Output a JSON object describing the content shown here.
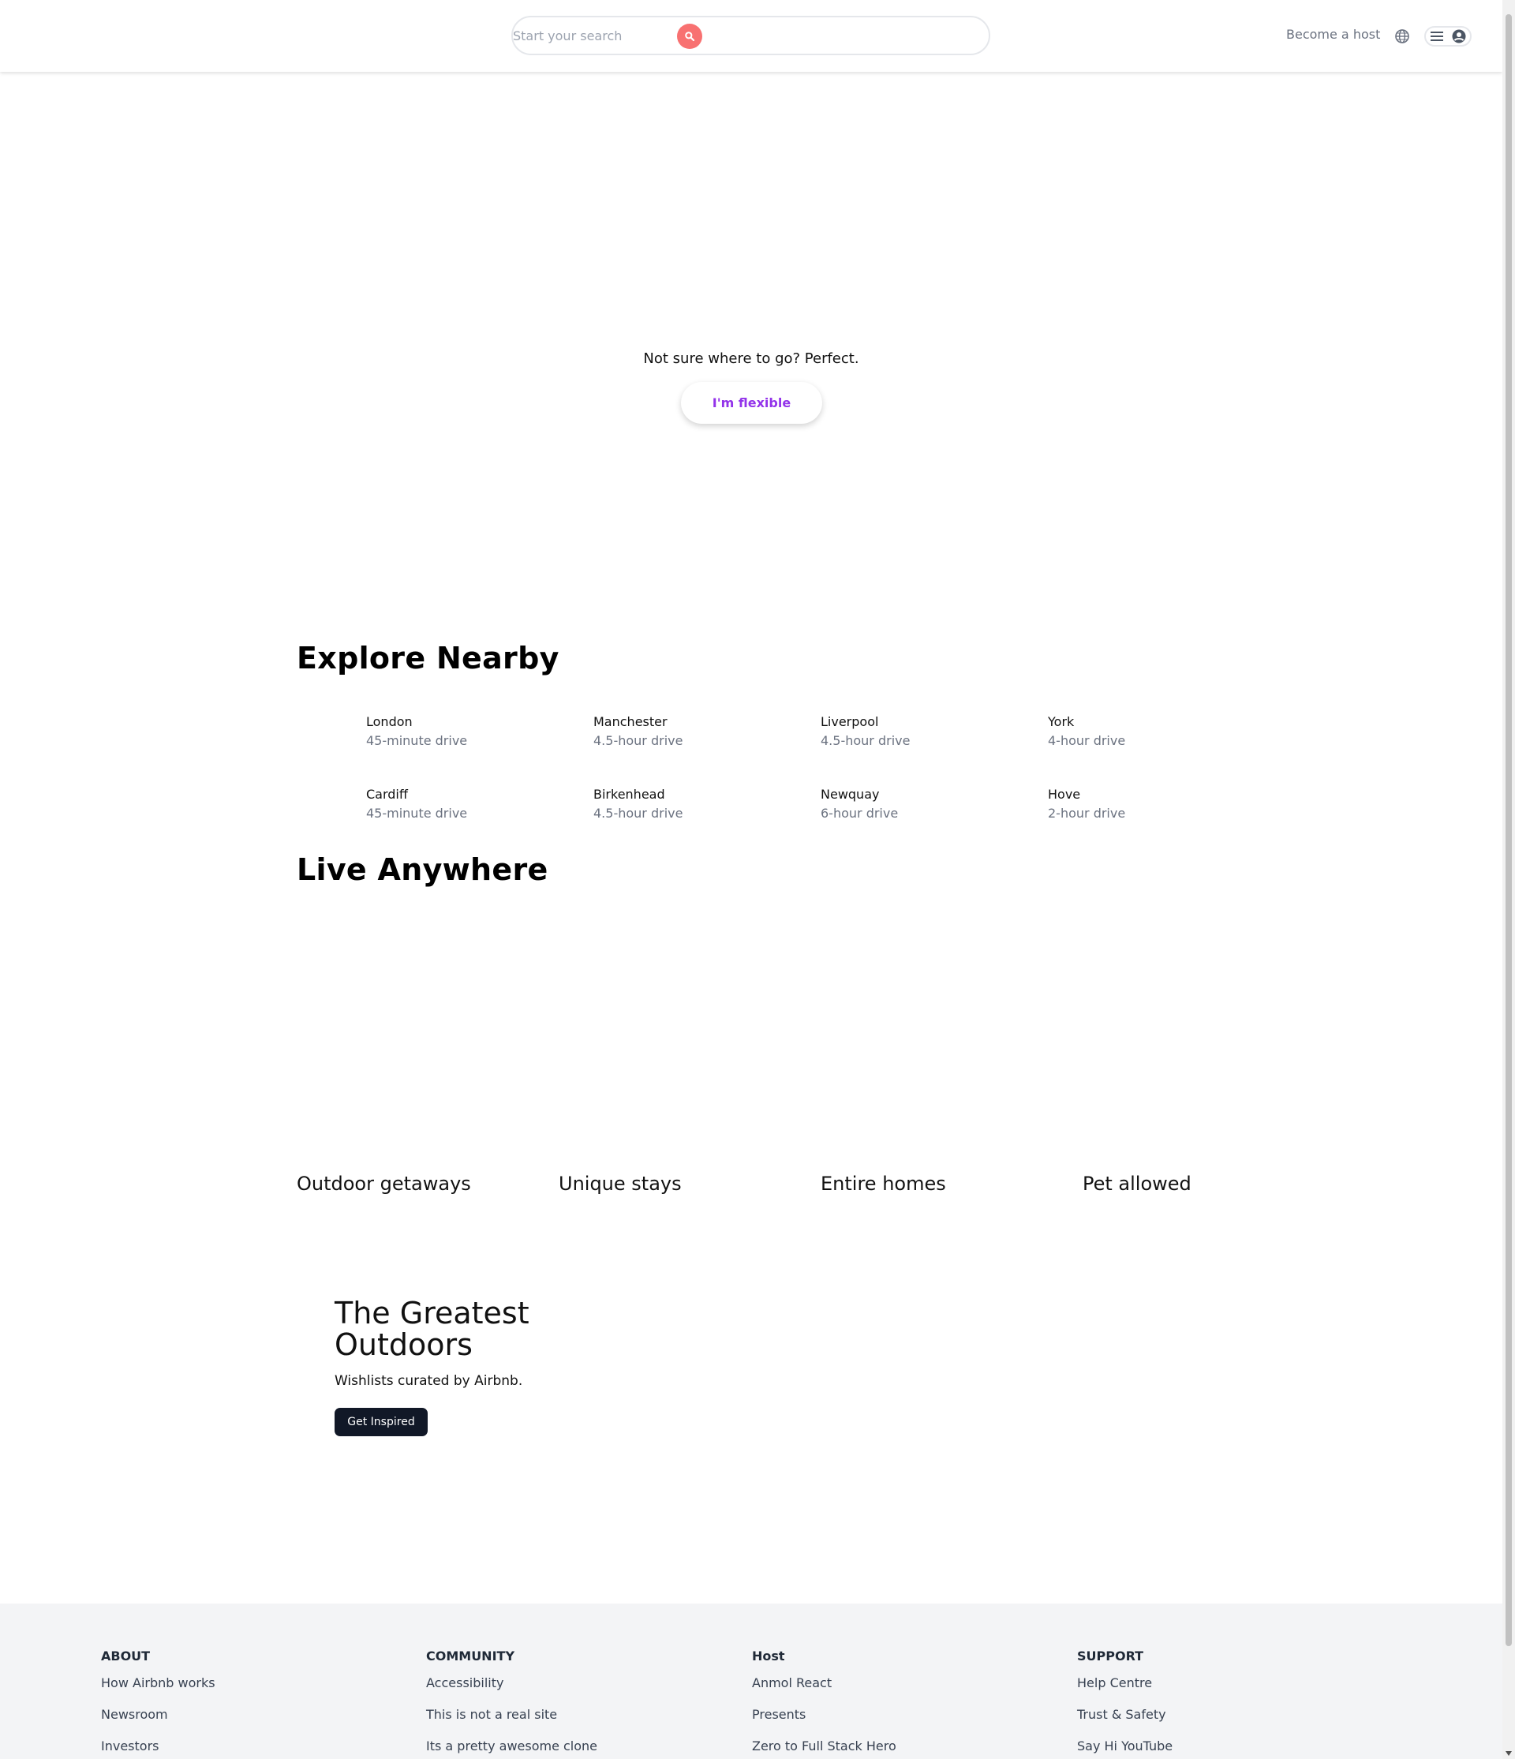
{
  "header": {
    "search_placeholder": "Start your search",
    "host_label": "Become a host"
  },
  "hero": {
    "tagline": "Not sure where to go? Perfect.",
    "flexible_button": "I'm flexible"
  },
  "explore": {
    "title": "Explore Nearby",
    "items": [
      {
        "city": "London",
        "distance": "45-minute drive"
      },
      {
        "city": "Manchester",
        "distance": "4.5-hour drive"
      },
      {
        "city": "Liverpool",
        "distance": "4.5-hour drive"
      },
      {
        "city": "York",
        "distance": "4-hour drive"
      },
      {
        "city": "Cardiff",
        "distance": "45-minute drive"
      },
      {
        "city": "Birkenhead",
        "distance": "4.5-hour drive"
      },
      {
        "city": "Newquay",
        "distance": "6-hour drive"
      },
      {
        "city": "Hove",
        "distance": "2-hour drive"
      }
    ]
  },
  "live": {
    "title": "Live Anywhere",
    "cards": [
      {
        "title": "Outdoor getaways"
      },
      {
        "title": "Unique stays"
      },
      {
        "title": "Entire homes"
      },
      {
        "title": "Pet allowed"
      }
    ]
  },
  "promo": {
    "title": "The Greatest Outdoors",
    "subtitle": "Wishlists curated by Airbnb.",
    "button": "Get Inspired"
  },
  "footer": {
    "columns": [
      {
        "heading": "ABOUT",
        "links": [
          "How Airbnb works",
          "Newsroom",
          "Investors"
        ]
      },
      {
        "heading": "COMMUNITY",
        "links": [
          "Accessibility",
          "This is not a real site",
          "Its a pretty awesome clone"
        ]
      },
      {
        "heading": "Host",
        "links": [
          "Anmol React",
          "Presents",
          "Zero to Full Stack Hero"
        ]
      },
      {
        "heading": "SUPPORT",
        "links": [
          "Help Centre",
          "Trust & Safety",
          "Say Hi YouTube"
        ]
      }
    ]
  },
  "colors": {
    "search_button": "#f87171",
    "flexible_text": "#9333ea",
    "promo_button": "#111827",
    "footer_bg": "#f3f4f6"
  },
  "icons": [
    "search-icon",
    "globe-icon",
    "menu-icon",
    "user-circle-icon"
  ]
}
